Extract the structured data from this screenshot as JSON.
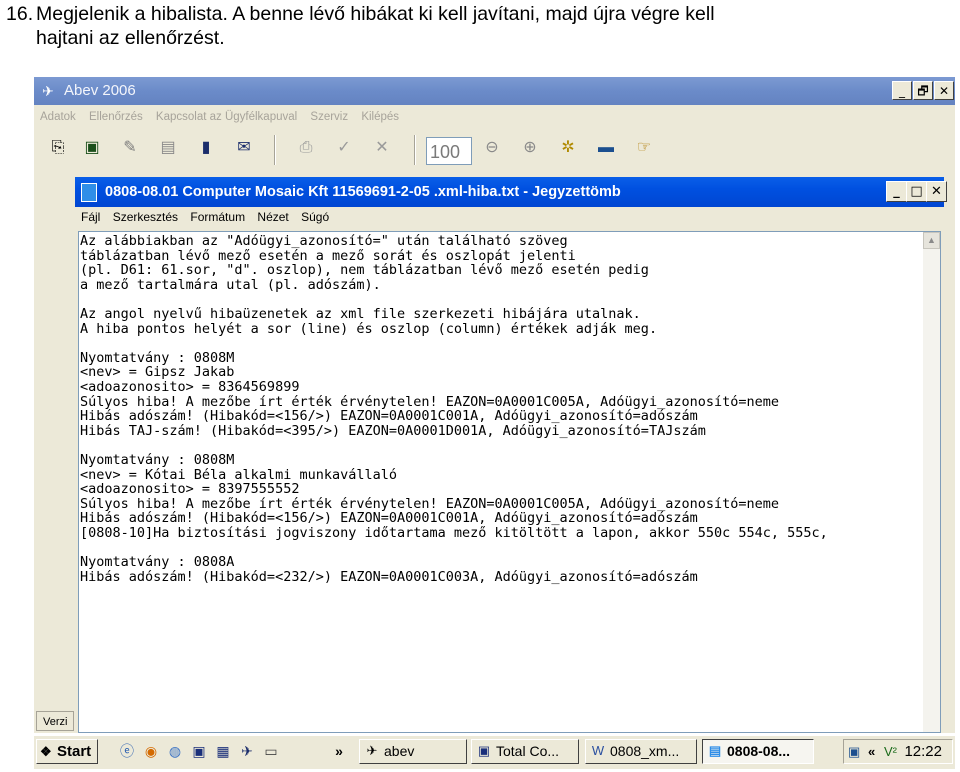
{
  "caption": {
    "number": "16.",
    "line1": "Megjelenik a hibalista. A benne lévő hibákat ki kell javítani, majd újra végre kell",
    "line2": "hajtani az ellenőrzést."
  },
  "abev": {
    "title": "Abev 2006",
    "menu": [
      "Adatok",
      "Ellenőrzés",
      "Kapcsolat az Ügyfélkapuval",
      "Szerviz",
      "Kilépés"
    ],
    "zoom": "100",
    "status_text": "Verzi",
    "window_buttons": [
      "_",
      "🗗",
      "✕"
    ]
  },
  "notepad": {
    "title": "0808-08.01 Computer Mosaic Kft 11569691-2-05 .xml-hiba.txt - Jegyzettömb",
    "menu": [
      "Fájl",
      "Szerkesztés",
      "Formátum",
      "Nézet",
      "Súgó"
    ],
    "window_buttons": [
      "_",
      "□",
      "✕"
    ],
    "lines": [
      "Az alábbiakban az \"Adóügyi_azonosító=\" után található szöveg",
      "táblázatban lévő mező esetén a mező sorát és oszlopát jelenti",
      "(pl. D61: 61.sor, \"d\". oszlop), nem táblázatban lévő mező esetén pedig",
      "a mező tartalmára utal (pl. adószám).",
      "",
      "Az angol nyelvű hibaüzenetek az xml file szerkezeti hibájára utalnak.",
      "A hiba pontos helyét a sor (line) és oszlop (column) értékek adják meg.",
      "",
      "Nyomtatvány : 0808M",
      "<nev> = Gipsz Jakab",
      "<adoazonosito> = 8364569899",
      "Súlyos hiba! A mezőbe írt érték érvénytelen! EAZON=0A0001C005A, Adóügyi_azonosító=neme",
      "Hibás adószám! (Hibakód=<156/>) EAZON=0A0001C001A, Adóügyi_azonosító=adószám",
      "Hibás TAJ-szám! (Hibakód=<395/>) EAZON=0A0001D001A, Adóügyi_azonosító=TAJszám",
      "",
      "Nyomtatvány : 0808M",
      "<nev> = Kótai Béla alkalmi munkavállaló",
      "<adoazonosito> = 8397555552",
      "Súlyos hiba! A mezőbe írt érték érvénytelen! EAZON=0A0001C005A, Adóügyi_azonosító=neme",
      "Hibás adószám! (Hibakód=<156/>) EAZON=0A0001C001A, Adóügyi_azonosító=adószám",
      "[0808-10]Ha biztosítási jogviszony időtartama mező kitöltött a lapon, akkor 550c 554c, 555c,",
      "",
      "Nyomtatvány : 0808A",
      "Hibás adószám! (Hibakód=<232/>) EAZON=0A0001C003A, Adóügyi_azonosító=adószám"
    ]
  },
  "taskbar": {
    "start_label": "Start",
    "chevron": "»",
    "tasks": [
      {
        "label": "abev",
        "icon": "abev-icon"
      },
      {
        "label": "Total Co...",
        "icon": "total-commander-icon"
      },
      {
        "label": "0808_xm...",
        "icon": "word-icon"
      },
      {
        "label": "0808-08...",
        "icon": "notepad-icon",
        "active": true
      }
    ],
    "tray_chevron": "«",
    "clock": "12:22"
  }
}
